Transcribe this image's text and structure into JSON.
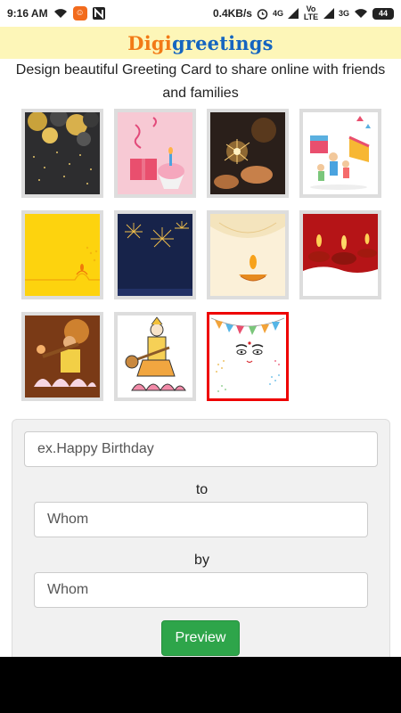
{
  "status_bar": {
    "time": "9:16 AM",
    "speed_value": "0.4KB/s",
    "net1": "4G",
    "net2": "3G",
    "volte": "Vo LTE",
    "battery": "44"
  },
  "brand": {
    "part1": "Digi",
    "part2": "greetings"
  },
  "tagline": "Design beautiful Greeting Card to share online with friends and families",
  "cards": [
    {
      "name": "balloons-card",
      "selected": false
    },
    {
      "name": "cupcake-card",
      "selected": false
    },
    {
      "name": "sparklers-card",
      "selected": false
    },
    {
      "name": "birthday-party-card",
      "selected": false
    },
    {
      "name": "yellow-diya-card",
      "selected": false
    },
    {
      "name": "fireworks-card",
      "selected": false
    },
    {
      "name": "cream-diya-card",
      "selected": false
    },
    {
      "name": "red-diyas-card",
      "selected": false
    },
    {
      "name": "saraswati-card",
      "selected": false
    },
    {
      "name": "saraswati-sketch-card",
      "selected": false
    },
    {
      "name": "durga-bunting-card",
      "selected": true
    }
  ],
  "form": {
    "greeting_placeholder": "ex.Happy Birthday",
    "to_label": "to",
    "to_placeholder": "Whom",
    "by_label": "by",
    "by_placeholder": "Whom",
    "preview_label": "Preview"
  },
  "colors": {
    "brand_orange": "#f27a16",
    "brand_blue": "#1565c0",
    "header_bg": "#fdf6b8",
    "preview_green": "#2ea54a",
    "selected_border": "#ee0000"
  }
}
